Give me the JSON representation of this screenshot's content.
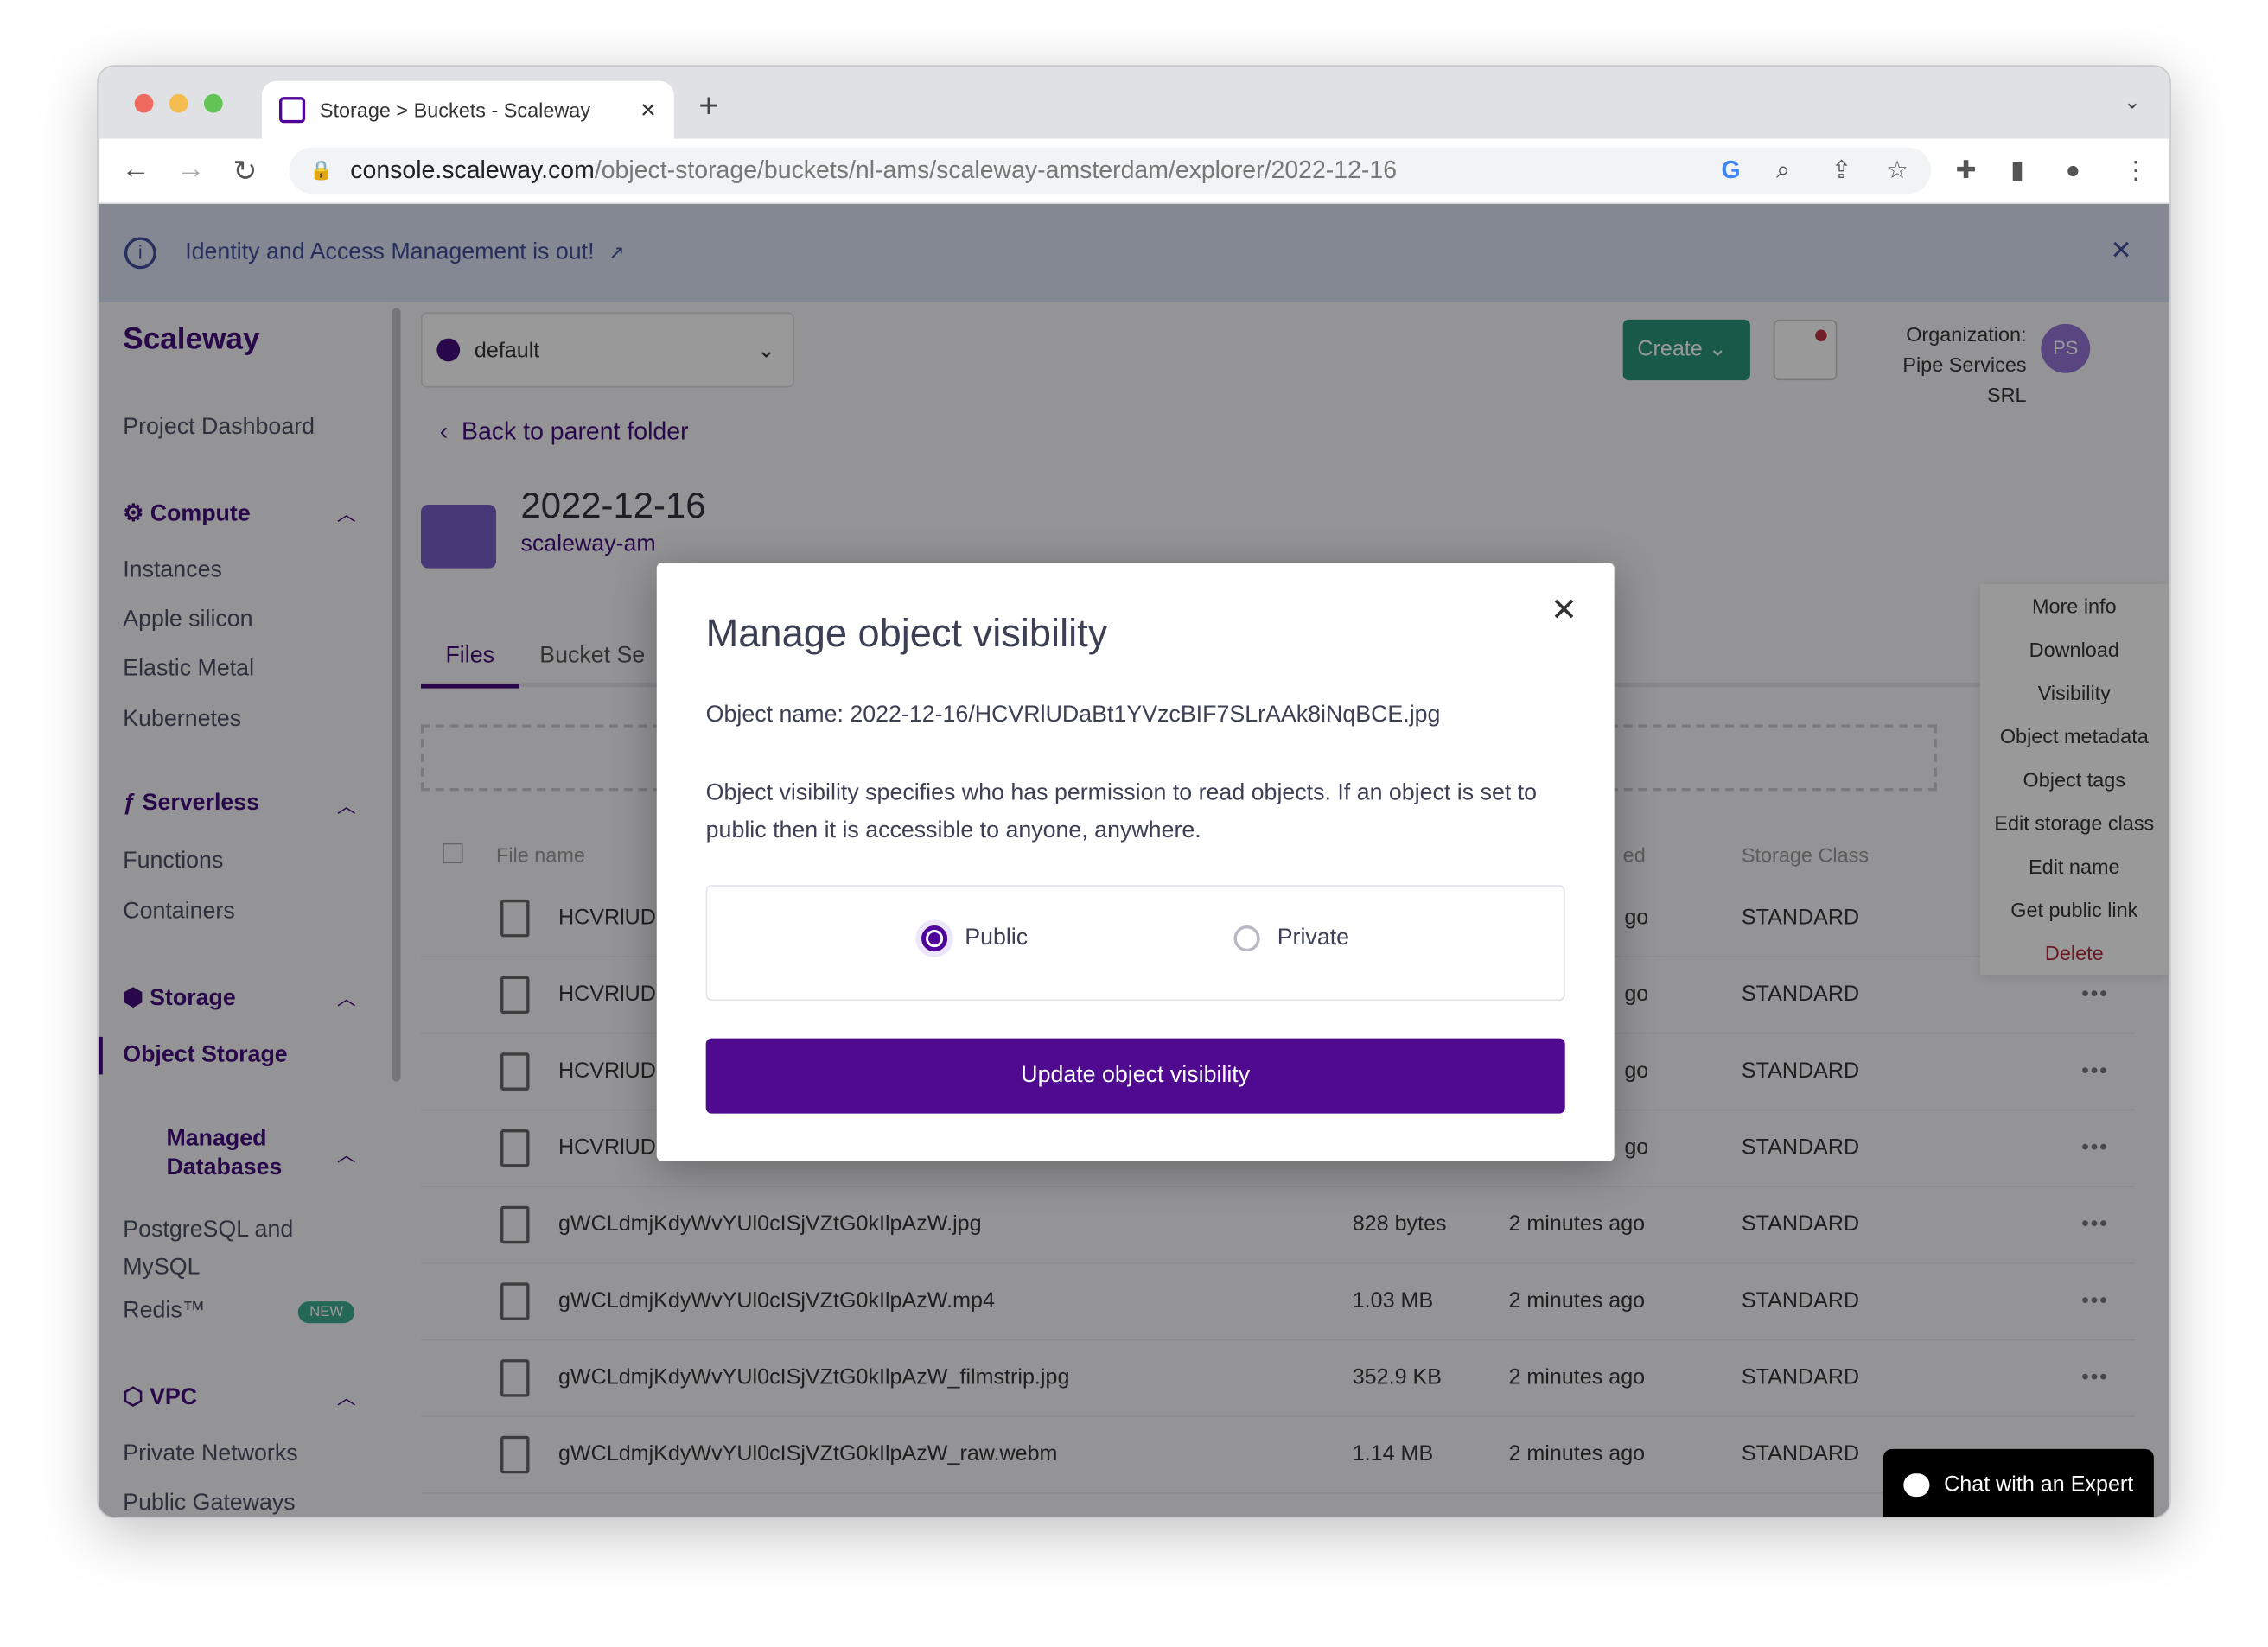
{
  "browser": {
    "tab_title": "Storage > Buckets - Scaleway",
    "url_host": "console.scaleway.com",
    "url_path": "/object-storage/buckets/nl-ams/scaleway-amsterdam/explorer/2022-12-16"
  },
  "banner": {
    "text": "Identity and Access Management is out!"
  },
  "sidebar": {
    "logo": "Scaleway",
    "project_dashboard": "Project Dashboard",
    "sections": [
      {
        "title": "Compute",
        "items": [
          "Instances",
          "Apple silicon",
          "Elastic Metal",
          "Kubernetes"
        ]
      },
      {
        "title": "Serverless",
        "items": [
          "Functions",
          "Containers"
        ]
      },
      {
        "title": "Storage",
        "items": [
          "Object Storage"
        ]
      },
      {
        "title": "Managed Databases",
        "items": [
          "PostgreSQL and MySQL",
          "Redis™"
        ]
      },
      {
        "title": "VPC",
        "items": [
          "Private Networks",
          "Public Gateways"
        ]
      }
    ],
    "new_badge": "NEW"
  },
  "header": {
    "project": "default",
    "create": "Create",
    "org_label": "Organization:",
    "org_name": "Pipe Services SRL",
    "avatar": "PS"
  },
  "main": {
    "back": "Back to parent folder",
    "folder_title": "2022-12-16",
    "folder_sub": "scaleway-am",
    "tabs": [
      "Files",
      "Bucket Se"
    ],
    "columns": {
      "name": "File name",
      "modified": "ed",
      "storage": "Storage Class"
    },
    "rows": [
      {
        "name": "HCVRlUD",
        "size": "",
        "modified": "go",
        "storage": "STANDARD"
      },
      {
        "name": "HCVRlUD",
        "size": "",
        "modified": "go",
        "storage": "STANDARD"
      },
      {
        "name": "HCVRlUD",
        "size": "",
        "modified": "go",
        "storage": "STANDARD"
      },
      {
        "name": "HCVRlUD",
        "size": "",
        "modified": "go",
        "storage": "STANDARD"
      },
      {
        "name": "gWCLdmjKdyWvYUl0cISjVZtG0kIlpAzW.jpg",
        "size": "828 bytes",
        "modified": "2 minutes ago",
        "storage": "STANDARD"
      },
      {
        "name": "gWCLdmjKdyWvYUl0cISjVZtG0kIlpAzW.mp4",
        "size": "1.03 MB",
        "modified": "2 minutes ago",
        "storage": "STANDARD"
      },
      {
        "name": "gWCLdmjKdyWvYUl0cISjVZtG0kIlpAzW_filmstrip.jpg",
        "size": "352.9 KB",
        "modified": "2 minutes ago",
        "storage": "STANDARD"
      },
      {
        "name": "gWCLdmjKdyWvYUl0cISjVZtG0kIlpAzW_raw.webm",
        "size": "1.14 MB",
        "modified": "2 minutes ago",
        "storage": "STANDARD"
      }
    ]
  },
  "context_menu": [
    "More info",
    "Download",
    "Visibility",
    "Object metadata",
    "Object tags",
    "Edit storage class",
    "Edit name",
    "Get public link",
    "Delete"
  ],
  "chat": "Chat with an Expert",
  "modal": {
    "title": "Manage object visibility",
    "object_name": "Object name: 2022-12-16/HCVRlUDaBt1YVzcBIF7SLrAAk8iNqBCE.jpg",
    "description": "Object visibility specifies who has permission to read objects. If an object is set to public then it is accessible to anyone, anywhere.",
    "options": [
      "Public",
      "Private"
    ],
    "selected": "Public",
    "submit": "Update object visibility"
  },
  "colors": {
    "brand": "#4f0599",
    "create": "#0f9d78",
    "delete": "#d6203c"
  }
}
